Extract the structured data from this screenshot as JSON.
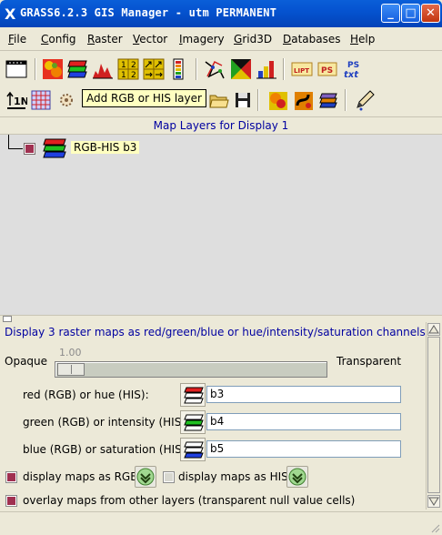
{
  "window": {
    "title": "GRASS6.2.3 GIS Manager - utm PERMANENT",
    "minimize_label": "_",
    "maximize_label": "□",
    "close_label": "✕"
  },
  "menubar": {
    "items": [
      {
        "first": "F",
        "rest": "ile"
      },
      {
        "first": "C",
        "rest": "onfig"
      },
      {
        "first": "R",
        "rest": "aster"
      },
      {
        "first": "V",
        "rest": "ector"
      },
      {
        "first": "I",
        "rest": "magery"
      },
      {
        "first": "G",
        "rest": "rid3D"
      },
      {
        "first": "D",
        "rest": "atabases"
      },
      {
        "first": "H",
        "rest": "elp"
      }
    ]
  },
  "toolbar1": {
    "lipt_label": "LIPT",
    "ps_label": "PS",
    "pstxt_label_top": "PS",
    "pstxt_label_bottom": "txt",
    "reclass_labels": [
      "1",
      "2",
      "1",
      "2"
    ]
  },
  "toolbar2": {
    "north_label": "1N",
    "tooltip": "Add RGB or HIS layer"
  },
  "layers": {
    "header": "Map Layers for Display 1",
    "items": [
      {
        "label": "RGB-HIS b3",
        "checked": true
      }
    ]
  },
  "props": {
    "description": "Display 3 raster maps as red/green/blue or hue/intensity/saturation channels",
    "opaque_label": "Opaque",
    "transparent_label": "Transparent",
    "opacity_value": "1.00",
    "red_label": "red (RGB) or hue (HIS):",
    "red_value": "b3",
    "green_label": "green (RGB) or intensity (HIS):",
    "green_value": "b4",
    "blue_label": "blue (RGB) or saturation (HIS):",
    "blue_value": "b5",
    "display_rgb_label": "display maps as RGB",
    "display_rgb_checked": true,
    "display_his_label": "display maps as HIS",
    "display_his_checked": false,
    "overlay_label": "overlay maps from other layers (transparent null value cells)",
    "overlay_checked": true
  },
  "colors": {
    "title_bar": "#0553d0",
    "check_on": "#a03050",
    "tooltip_bg": "#ffffc0",
    "header_text": "#0000a0"
  }
}
